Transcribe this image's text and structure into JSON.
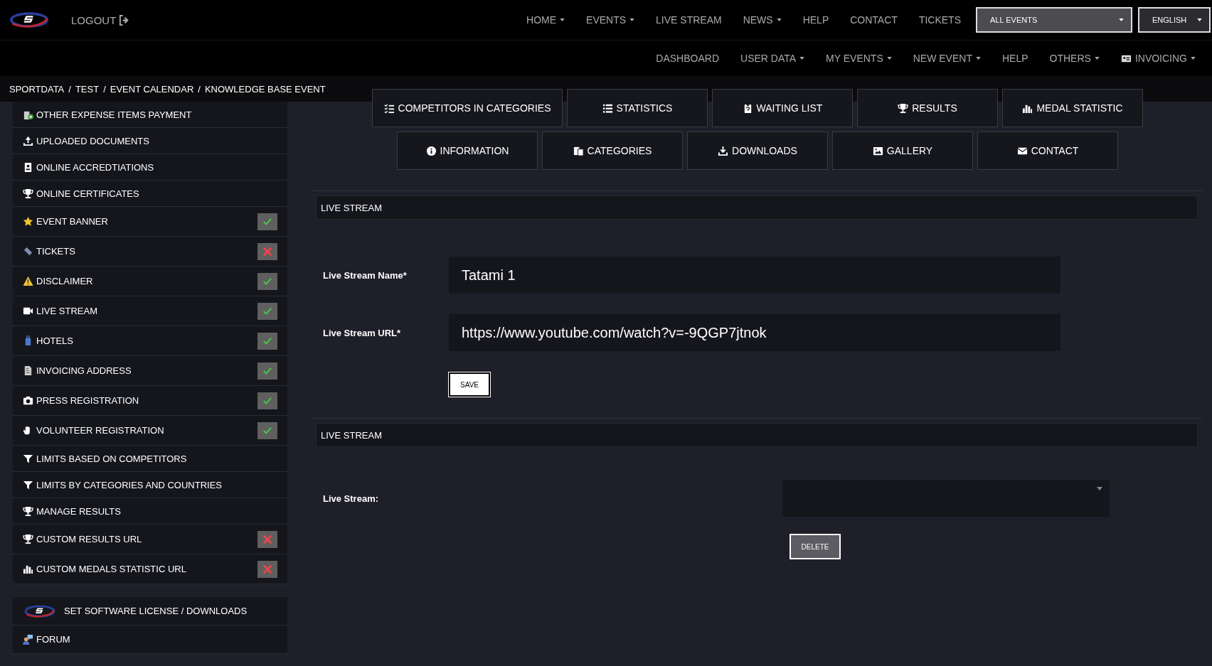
{
  "header": {
    "logout": "LOGOUT",
    "nav": [
      {
        "label": "HOME",
        "dropdown": true
      },
      {
        "label": "EVENTS",
        "dropdown": true
      },
      {
        "label": "LIVE STREAM",
        "dropdown": false
      },
      {
        "label": "NEWS",
        "dropdown": true
      },
      {
        "label": "HELP",
        "dropdown": false
      },
      {
        "label": "CONTACT",
        "dropdown": false
      },
      {
        "label": "TICKETS",
        "dropdown": false
      }
    ],
    "event_select": {
      "value": "ALL EVENTS"
    },
    "language_select": {
      "value": "ENGLISH"
    },
    "subnav": [
      {
        "label": "DASHBOARD",
        "dropdown": false
      },
      {
        "label": "USER DATA",
        "dropdown": true
      },
      {
        "label": "MY EVENTS",
        "dropdown": true
      },
      {
        "label": "NEW EVENT",
        "dropdown": true
      },
      {
        "label": "HELP",
        "dropdown": false
      },
      {
        "label": "OTHERS",
        "dropdown": true
      },
      {
        "label": "INVOICING",
        "dropdown": true
      }
    ]
  },
  "breadcrumb": {
    "separator": "/",
    "items": [
      "SPORTDATA",
      "TEST",
      "EVENT CALENDAR",
      "KNOWLEDGE BASE EVENT"
    ]
  },
  "sidebar": {
    "items": [
      {
        "label": "OTHER EXPENSE ITEMS PAYMENT"
      },
      {
        "label": "UPLOADED DOCUMENTS"
      },
      {
        "label": "ONLINE ACCREDTIATIONS"
      },
      {
        "label": "ONLINE CERTIFICATES"
      },
      {
        "label": "EVENT BANNER",
        "checked": true
      },
      {
        "label": "TICKETS",
        "checked": false
      },
      {
        "label": "DISCLAIMER",
        "checked": true
      },
      {
        "label": "LIVE STREAM",
        "checked": true
      },
      {
        "label": "HOTELS",
        "checked": true
      },
      {
        "label": "INVOICING ADDRESS",
        "checked": true
      },
      {
        "label": "PRESS REGISTRATION",
        "checked": true
      },
      {
        "label": "VOLUNTEER REGISTRATION",
        "checked": true
      },
      {
        "label": "LIMITS BASED ON COMPETITORS"
      },
      {
        "label": "LIMITS BY CATEGORIES AND COUNTRIES"
      },
      {
        "label": "MANAGE RESULTS"
      },
      {
        "label": "CUSTOM RESULTS URL",
        "checked": false
      },
      {
        "label": "CUSTOM MEDALS STATISTIC URL",
        "checked": false
      }
    ],
    "footer_items": [
      {
        "label": "SET SOFTWARE LICENSE / DOWNLOADS"
      },
      {
        "label": "FORUM"
      }
    ]
  },
  "tabs": [
    [
      "COMPETITORS IN CATEGORIES",
      "STATISTICS",
      "WAITING LIST",
      "RESULTS",
      "MEDAL STATISTIC"
    ],
    [
      "INFORMATION",
      "CATEGORIES",
      "DOWNLOADS",
      "GALLERY",
      "CONTACT"
    ]
  ],
  "sections": [
    {
      "title": "LIVE STREAM",
      "kind": "form",
      "fields": [
        {
          "label": "Live Stream Name*",
          "value": "Tatami 1"
        },
        {
          "label": "Live Stream URL*",
          "value": "https://www.youtube.com/watch?v=-9QGP7jtnok"
        }
      ],
      "button": "SAVE"
    },
    {
      "title": "LIVE STREAM",
      "kind": "select",
      "label": "Live Stream:",
      "button": "DELETE"
    }
  ]
}
